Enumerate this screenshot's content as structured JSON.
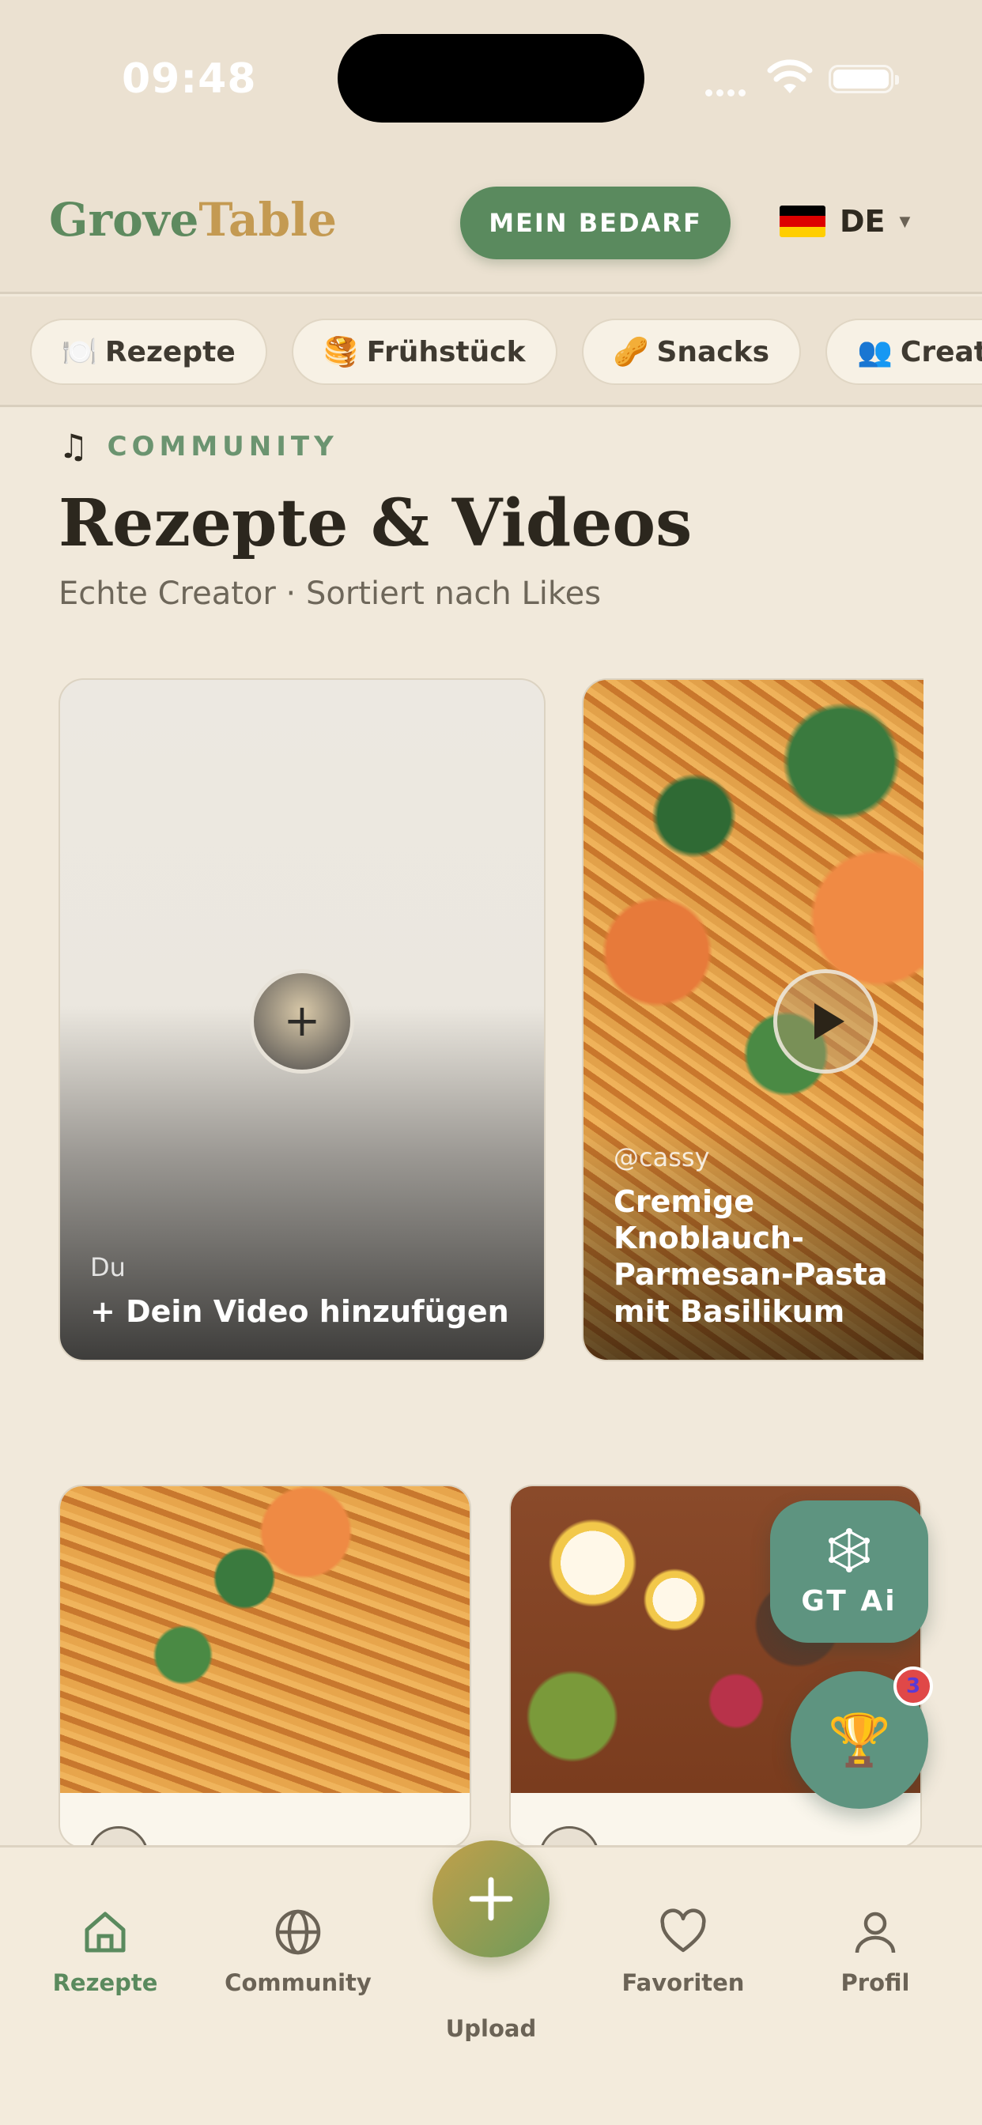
{
  "status_bar": {
    "time": "09:48"
  },
  "header": {
    "logo_part1": "Grove",
    "logo_part2": "Table",
    "bedarf_button": "MEIN BEDARF",
    "language": "DE",
    "flag_colors": [
      "#000000",
      "#dd0000",
      "#ffce00"
    ]
  },
  "categories": [
    {
      "emoji": "🍽️",
      "label": "Rezepte"
    },
    {
      "emoji": "🥞",
      "label": "Frühstück"
    },
    {
      "emoji": "🥜",
      "label": "Snacks"
    },
    {
      "emoji": "👥",
      "label": "Creators"
    }
  ],
  "section": {
    "eyebrow": "COMMUNITY",
    "title": "Rezepte & Videos",
    "subtitle": "Echte Creator · Sortiert nach Likes"
  },
  "videos": [
    {
      "user": "Du",
      "title": "+ Dein Video hinzufügen",
      "icon": "plus-icon"
    },
    {
      "user": "@cassy",
      "title": "Cremige Knoblauch-Parmesan-Pasta mit Basilikum",
      "icon": "play-icon"
    }
  ],
  "floating": {
    "gt_ai_label": "GT Ai",
    "trophy_badge": "3"
  },
  "tabbar": {
    "items": [
      {
        "label": "Rezepte",
        "icon": "home-icon",
        "active": true
      },
      {
        "label": "Community",
        "icon": "globe-icon",
        "active": false
      },
      {
        "label": "Upload",
        "icon": "plus-icon",
        "active": false
      },
      {
        "label": "Favoriten",
        "icon": "heart-icon",
        "active": false
      },
      {
        "label": "Profil",
        "icon": "user-icon",
        "active": false
      }
    ]
  },
  "colors": {
    "accent_green": "#5a8a5e",
    "teal": "#5e9480",
    "gold": "#c49a52",
    "background": "#f1e9db"
  }
}
